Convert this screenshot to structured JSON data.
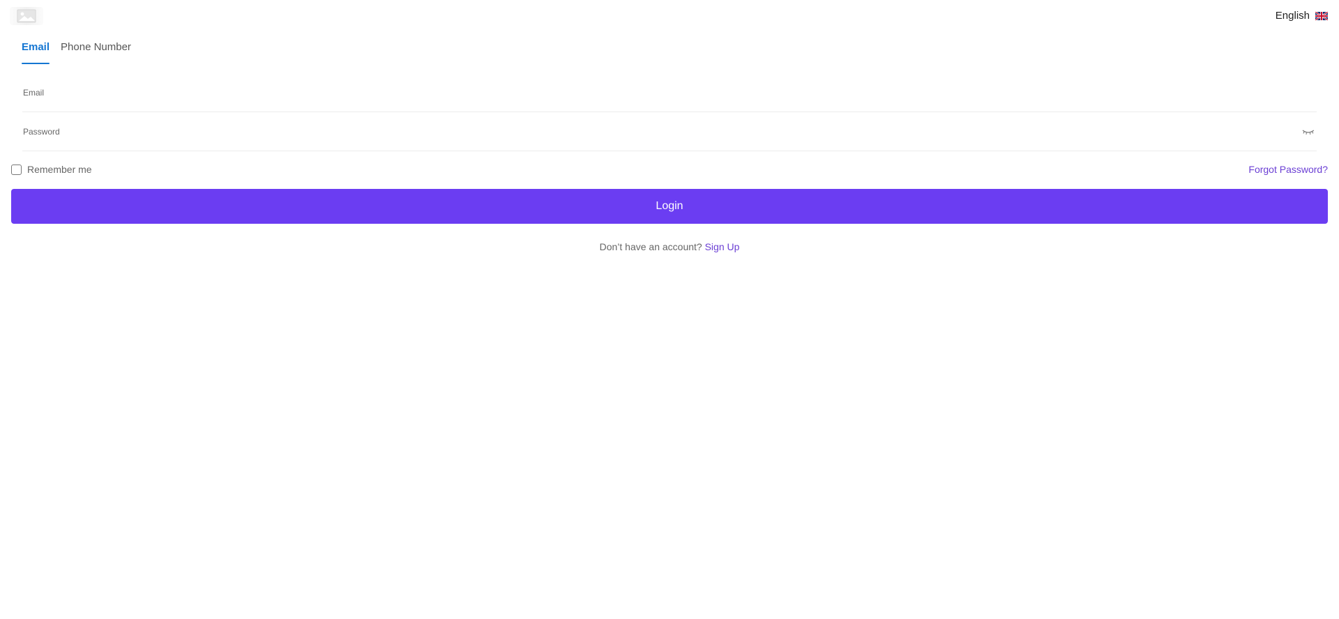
{
  "header": {
    "logo_icon": "image-placeholder-icon",
    "language": "English",
    "language_flag_icon": "uk-flag-icon"
  },
  "tabs": [
    {
      "label": "Email",
      "active": true
    },
    {
      "label": "Phone Number",
      "active": false
    }
  ],
  "form": {
    "email_placeholder": "Email",
    "password_placeholder": "Password",
    "password_toggle_icon": "eye-closed-icon",
    "remember_label": "Remember me",
    "forgot_label": "Forgot Password?",
    "login_label": "Login"
  },
  "signup": {
    "prompt": "Don’t have an account?",
    "link_label": "Sign Up"
  },
  "colors": {
    "primary": "#6b3df2",
    "link": "#6b3fd4",
    "active_tab": "#1576d2"
  }
}
